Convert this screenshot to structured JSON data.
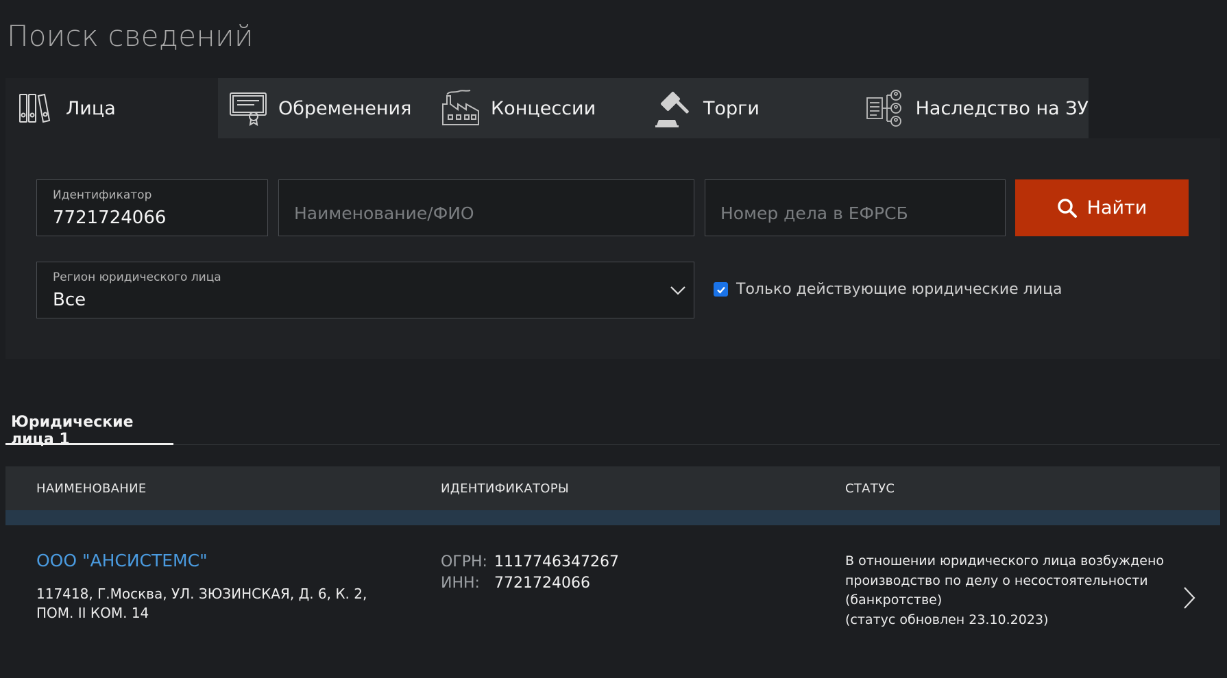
{
  "page": {
    "title": "Поиск сведений"
  },
  "tabs": [
    {
      "label": "Лица",
      "icon": "binders-icon",
      "active": true
    },
    {
      "label": "Обременения",
      "icon": "certificate-icon",
      "active": false
    },
    {
      "label": "Концессии",
      "icon": "factory-icon",
      "active": false
    },
    {
      "label": "Торги",
      "icon": "gavel-icon",
      "active": false
    },
    {
      "label": "Наследство на ЗУ",
      "icon": "inheritance-icon",
      "active": false
    }
  ],
  "search": {
    "identifier_caption": "Идентификатор",
    "identifier_value": "7721724066",
    "name_placeholder": "Наименование/ФИО",
    "case_placeholder": "Номер дела в ЕФРСБ",
    "find_label": "Найти",
    "region_caption": "Регион юридического лица",
    "region_value": "Все",
    "active_only_label": "Только действующие юридические лица",
    "active_only_checked": true
  },
  "results": {
    "tab_label": "Юридические лица 1",
    "columns": [
      "НАИМЕНОВАНИЕ",
      "ИДЕНТИФИКАТОРЫ",
      "СТАТУС"
    ],
    "rows": [
      {
        "name": "ООО \"АНСИСТЕМС\"",
        "address": "117418, Г.Москва, УЛ. ЗЮЗИНСКАЯ, Д. 6, К. 2, ПОМ. II КОМ. 14",
        "ogrn_label": "ОГРН:",
        "ogrn": "1117746347267",
        "inn_label": "ИНН:",
        "inn": "7721724066",
        "status_line1": "В отношении юридического лица возбуждено производство по делу о несостоятельности (банкротстве)",
        "status_line2": "(статус обновлен 23.10.2023)"
      }
    ]
  },
  "colors": {
    "background": "#1c1e21",
    "panel": "#202225",
    "tab": "#2b2e31",
    "accent_button": "#b93007",
    "link": "#4a9be0",
    "checkbox": "#1a73e8"
  }
}
